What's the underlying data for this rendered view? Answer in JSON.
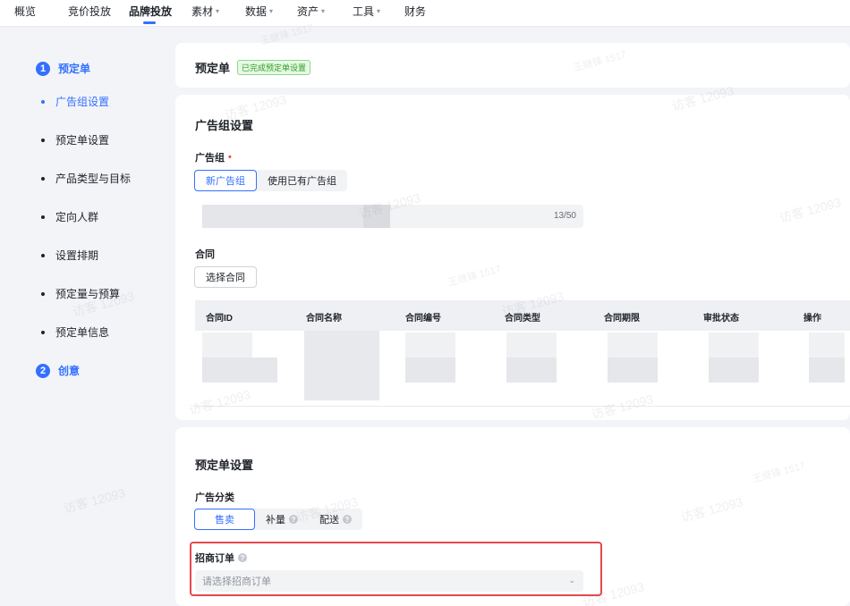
{
  "nav": {
    "items": [
      {
        "label": "概览",
        "dropdown": false
      },
      {
        "label": "竞价投放",
        "dropdown": false
      },
      {
        "label": "品牌投放",
        "dropdown": false,
        "active": true
      },
      {
        "label": "素材",
        "dropdown": true
      },
      {
        "label": "数据",
        "dropdown": true
      },
      {
        "label": "资产",
        "dropdown": true
      },
      {
        "label": "工具",
        "dropdown": true
      },
      {
        "label": "财务",
        "dropdown": false
      }
    ],
    "caret": "▾"
  },
  "steps": {
    "step1": {
      "num": "1",
      "title": "预定单"
    },
    "sub_items": [
      "广告组设置",
      "预定单设置",
      "产品类型与目标",
      "定向人群",
      "设置排期",
      "预定量与预算",
      "预定单信息"
    ],
    "active_sub": "广告组设置",
    "step2": {
      "num": "2",
      "title": "创意"
    }
  },
  "order": {
    "title": "预定单",
    "badge": "已完成预定单设置"
  },
  "adgroup_section": {
    "title": "广告组设置",
    "label": "广告组",
    "required_mark": "•",
    "options": [
      "新广告组",
      "使用已有广告组"
    ],
    "selected": "新广告组",
    "name_counter": "13/50"
  },
  "contract": {
    "label": "合同",
    "button": "选择合同",
    "columns": [
      "合同ID",
      "合同名称",
      "合同编号",
      "合同类型",
      "合同期限",
      "审批状态",
      "操作"
    ]
  },
  "order_settings": {
    "title": "预定单设置",
    "category_label": "广告分类",
    "options": [
      {
        "label": "售卖",
        "help": false
      },
      {
        "label": "补量",
        "help": true
      },
      {
        "label": "配送",
        "help": true
      }
    ],
    "selected": "售卖",
    "merchant_label": "招商订单",
    "merchant_placeholder": "请选择招商订单",
    "help_glyph": "?",
    "chevron": "⌄"
  },
  "watermark": {
    "text_a": "访客 12093",
    "text_b": "王继锋 1517"
  }
}
